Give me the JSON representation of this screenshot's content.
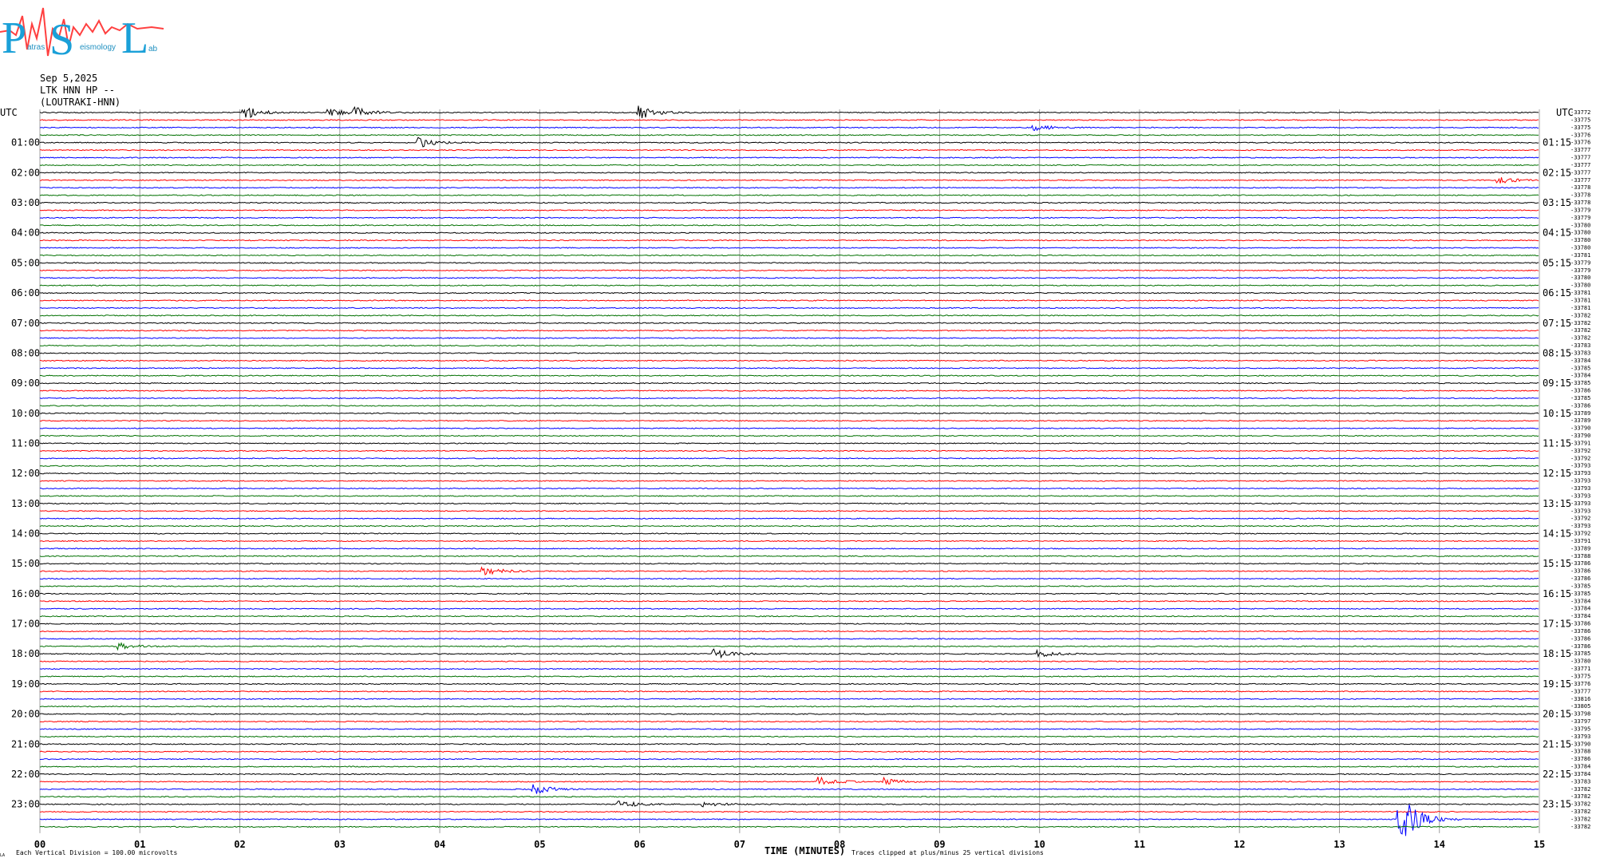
{
  "logo": {
    "letters": [
      "P",
      "S",
      "L"
    ],
    "subtext": [
      "atras",
      "eismology",
      "ab"
    ],
    "colors": {
      "letters": "#1aa0d8",
      "wave": "#ff4040"
    }
  },
  "header": {
    "date": "Sep 5,2025",
    "station": "LTK HNN HP --",
    "location": "(LOUTRAKI-HNN)"
  },
  "chart_data": {
    "type": "line",
    "title": "",
    "left_axis_title": "UTC",
    "right_axis_title": "UTC",
    "hour_labels_left": [
      "01:00",
      "02:00",
      "03:00",
      "04:00",
      "05:00",
      "06:00",
      "07:00",
      "08:00",
      "09:00",
      "10:00",
      "11:00",
      "12:00",
      "13:00",
      "14:00",
      "15:00",
      "16:00",
      "17:00",
      "18:00",
      "19:00",
      "20:00",
      "21:00",
      "22:00",
      "23:00"
    ],
    "hour_labels_right": [
      "01:15",
      "02:15",
      "03:15",
      "04:15",
      "05:15",
      "06:15",
      "07:15",
      "08:15",
      "09:15",
      "10:15",
      "11:15",
      "12:15",
      "13:15",
      "14:15",
      "15:15",
      "16:15",
      "17:15",
      "18:15",
      "19:15",
      "20:15",
      "21:15",
      "22:15",
      "23:15"
    ],
    "x_ticks": [
      "00",
      "01",
      "02",
      "03",
      "04",
      "05",
      "06",
      "07",
      "08",
      "09",
      "10",
      "11",
      "12",
      "13",
      "14",
      "15"
    ],
    "xlabel": "TIME (MINUTES)",
    "xlim": [
      0,
      15
    ],
    "grid": true,
    "trace_count": 96,
    "trace_minutes": 15,
    "trace_colors": [
      "#000000",
      "#ff0000",
      "#0000ff",
      "#007000"
    ],
    "trace_values": [
      "-33772",
      "-33775",
      "-33775",
      "-33776",
      "-33776",
      "-33777",
      "-33777",
      "-33777",
      "-33777",
      "-33777",
      "-33778",
      "-33778",
      "-33778",
      "-33779",
      "-33779",
      "-33780",
      "-33780",
      "-33780",
      "-33780",
      "-33781",
      "-33779",
      "-33779",
      "-33780",
      "-33780",
      "-33781",
      "-33781",
      "-33781",
      "-33782",
      "-33782",
      "-33782",
      "-33782",
      "-33783",
      "-33783",
      "-33784",
      "-33785",
      "-33784",
      "-33785",
      "-33786",
      "-33785",
      "-33786",
      "-33789",
      "-33789",
      "-33790",
      "-33790",
      "-33791",
      "-33792",
      "-33792",
      "-33793",
      "-33793",
      "-33793",
      "-33793",
      "-33793",
      "-33793",
      "-33793",
      "-33792",
      "-33793",
      "-33792",
      "-33791",
      "-33789",
      "-33788",
      "-33786",
      "-33786",
      "-33786",
      "-33785",
      "-33785",
      "-33784",
      "-33784",
      "-33784",
      "-33786",
      "-33786",
      "-33786",
      "-33786",
      "-33785",
      "-33780",
      "-33771",
      "-33775",
      "-33776",
      "-33777",
      "-33816",
      "-33805",
      "-33798",
      "-33797",
      "-33795",
      "-33793",
      "-33790",
      "-33788",
      "-33786",
      "-33784",
      "-33784",
      "-33783",
      "-33782",
      "-33782",
      "-33782",
      "-33782",
      "-33782",
      "-33782"
    ],
    "events": [
      {
        "row": 0,
        "minute": 2.05,
        "amp": 8
      },
      {
        "row": 0,
        "minute": 2.9,
        "amp": 5
      },
      {
        "row": 0,
        "minute": 3.15,
        "amp": 6
      },
      {
        "row": 0,
        "minute": 6.0,
        "amp": 9
      },
      {
        "row": 2,
        "minute": 9.95,
        "amp": 4
      },
      {
        "row": 4,
        "minute": 3.8,
        "amp": 6
      },
      {
        "row": 9,
        "minute": 14.6,
        "amp": 4
      },
      {
        "row": 61,
        "minute": 4.45,
        "amp": 6
      },
      {
        "row": 72,
        "minute": 6.75,
        "amp": 7
      },
      {
        "row": 72,
        "minute": 10.0,
        "amp": 4
      },
      {
        "row": 71,
        "minute": 0.8,
        "amp": 4
      },
      {
        "row": 89,
        "minute": 7.8,
        "amp": 6
      },
      {
        "row": 89,
        "minute": 8.45,
        "amp": 5
      },
      {
        "row": 90,
        "minute": 4.95,
        "amp": 6
      },
      {
        "row": 92,
        "minute": 5.8,
        "amp": 5
      },
      {
        "row": 92,
        "minute": 6.65,
        "amp": 4
      },
      {
        "row": 94,
        "minute": 13.6,
        "amp": 40
      }
    ]
  },
  "footer": {
    "left_text": "Each Vertical Division =  100.00 microvolts",
    "corner_text": "LA",
    "clip_text": "Traces clipped at plus/minus 25 vertical divisions"
  }
}
